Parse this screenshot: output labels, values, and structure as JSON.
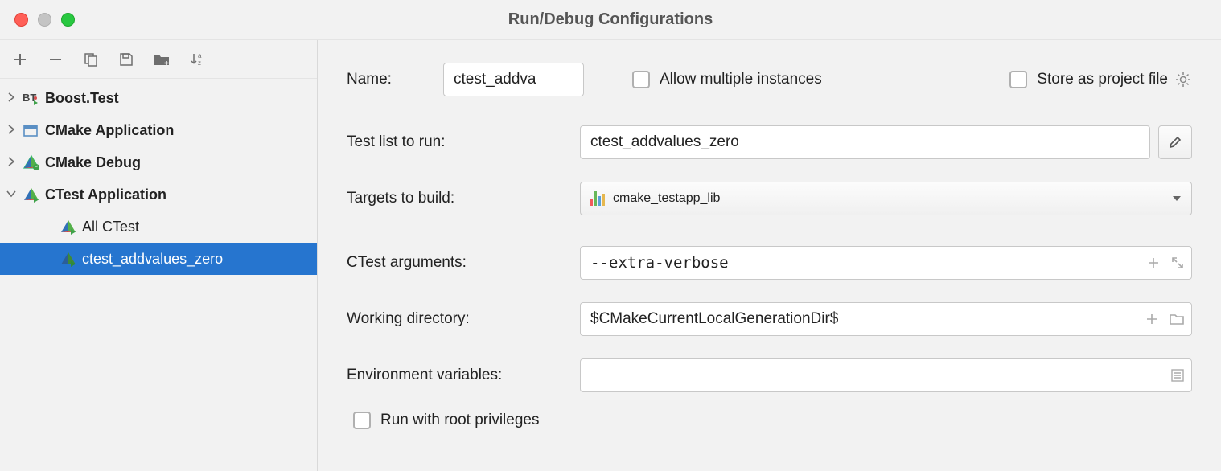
{
  "window": {
    "title": "Run/Debug Configurations"
  },
  "tree": {
    "items": [
      {
        "label": "Boost.Test"
      },
      {
        "label": "CMake Application"
      },
      {
        "label": "CMake Debug"
      },
      {
        "label": "CTest Application"
      },
      {
        "label": "All CTest"
      },
      {
        "label": "ctest_addvalues_zero"
      }
    ]
  },
  "form": {
    "name_label": "Name:",
    "name_value": "ctest_addva",
    "allow_multiple": "Allow multiple instances",
    "store_project": "Store as project file",
    "test_list_label": "Test list to run:",
    "test_list_value": "ctest_addvalues_zero",
    "targets_label": "Targets to build:",
    "targets_value": "cmake_testapp_lib",
    "ctest_args_label": "CTest arguments:",
    "ctest_args_value": "--extra-verbose",
    "workdir_label": "Working directory:",
    "workdir_value": "$CMakeCurrentLocalGenerationDir$",
    "env_label": "Environment variables:",
    "env_value": "",
    "root_priv": "Run with root privileges"
  }
}
